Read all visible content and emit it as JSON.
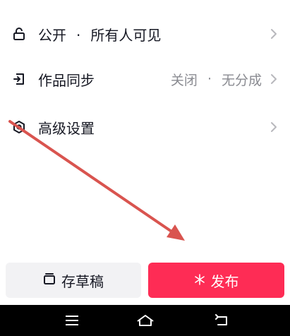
{
  "settings": {
    "items": [
      {
        "icon": "lock-icon",
        "label": "公开",
        "separator": "·",
        "inline_value": "所有人可见",
        "value": "",
        "value_separator": "",
        "value2": ""
      },
      {
        "icon": "sync-icon",
        "label": "作品同步",
        "separator": "",
        "inline_value": "",
        "value": "关闭",
        "value_separator": "·",
        "value2": "无分成"
      },
      {
        "icon": "shield-gear-icon",
        "label": "高级设置",
        "separator": "",
        "inline_value": "",
        "value": "",
        "value_separator": "",
        "value2": ""
      }
    ]
  },
  "actions": {
    "draft_label": "存草稿",
    "publish_label": "发布"
  },
  "colors": {
    "accent": "#fe2c55",
    "annotation_arrow": "#d9544f",
    "secondary_text": "#8a8b91",
    "draft_bg": "#f2f2f4"
  },
  "system_nav": {
    "icons": [
      "menu-icon",
      "home-icon",
      "back-icon"
    ]
  }
}
